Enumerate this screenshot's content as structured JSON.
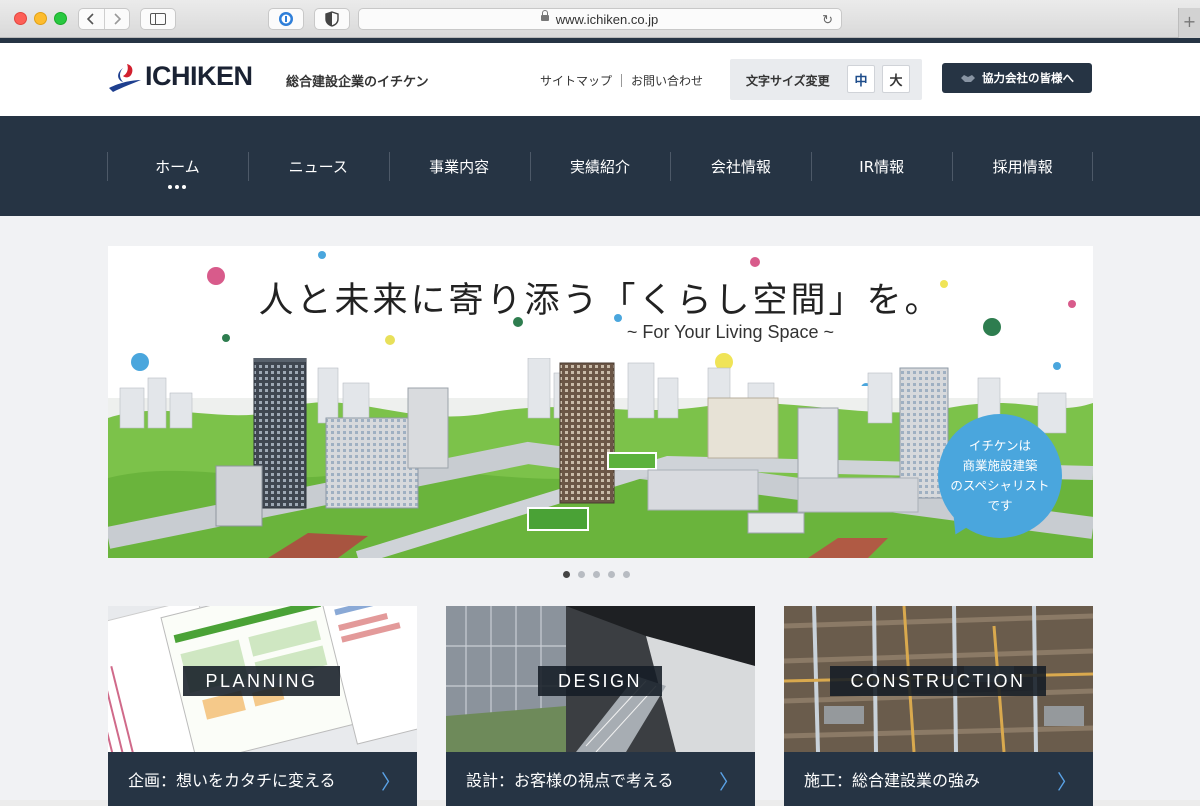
{
  "browser": {
    "url": "www.ichiken.co.jp",
    "new_tab_symbol": "+"
  },
  "header": {
    "logo_text": "ICHIKEN",
    "tagline": "総合建設企業のイチケン",
    "util_links": [
      "サイトマップ",
      "お問い合わせ"
    ],
    "font_size_label": "文字サイズ変更",
    "font_size_options": [
      "中",
      "大"
    ],
    "partner_button": "協力会社の皆様へ"
  },
  "nav": {
    "items": [
      "ホーム",
      "ニュース",
      "事業内容",
      "実績紹介",
      "会社情報",
      "IR情報",
      "採用情報"
    ],
    "active_index": 0
  },
  "hero": {
    "title": "人と未来に寄り添う「くらし空間」を。",
    "subtitle": "~ For Your Living Space ~",
    "bubble_lines": [
      "イチケンは",
      "商業施設建築",
      "のスペシャリスト",
      "です"
    ],
    "slide_count": 5,
    "active_slide": 1
  },
  "cards": [
    {
      "tag": "PLANNING",
      "caption": "企画：想いをカタチに変える",
      "arrow": "〉"
    },
    {
      "tag": "DESIGN",
      "caption": "設計：お客様の視点で考える",
      "arrow": "〉"
    },
    {
      "tag": "CONSTRUCTION",
      "caption": "施工：総合建設業の強み",
      "arrow": "〉"
    }
  ],
  "colors": {
    "navy": "#263444",
    "accent_blue": "#4aa6dd",
    "logo_red": "#d2202f",
    "logo_blue": "#1e3f8f"
  }
}
